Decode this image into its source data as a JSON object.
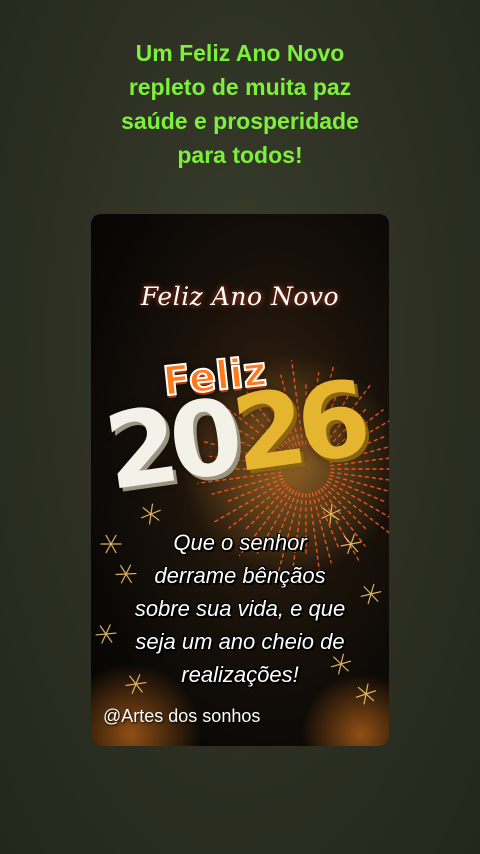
{
  "headline": {
    "lines": [
      "Um Feliz Ano Novo",
      "repleto de muita paz",
      "saúde e prosperidade",
      "para todos!"
    ]
  },
  "card": {
    "script_title": "Feliz Ano Novo",
    "badge": "Feliz",
    "year_first": "20",
    "year_second": "26",
    "message_lines": [
      "Que o senhor",
      "derrame bênçãos",
      "sobre sua vida, e que",
      "seja um ano cheio de",
      "realizações!"
    ],
    "credit": "@Artes dos sonhos"
  },
  "colors": {
    "headline": "#7cf03a",
    "background": "#2c2f22",
    "gold": "#e6b530",
    "badge_orange": "#ff7a1a"
  }
}
